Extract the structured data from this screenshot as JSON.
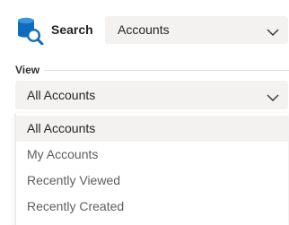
{
  "search": {
    "label": "Search",
    "entity_value": "Accounts"
  },
  "view": {
    "label": "View",
    "selected_value": "All Accounts",
    "options": [
      {
        "label": "All Accounts",
        "selected": true
      },
      {
        "label": "My Accounts",
        "selected": false
      },
      {
        "label": "Recently Viewed",
        "selected": false
      },
      {
        "label": "Recently Created",
        "selected": false
      }
    ]
  },
  "icons": {
    "search_entity": "database-search-icon",
    "chevron": "chevron-down-icon"
  },
  "colors": {
    "icon_blue": "#0078d4",
    "field_background": "#f3f2f1",
    "text_primary": "#242424",
    "text_secondary": "#605e5c"
  }
}
